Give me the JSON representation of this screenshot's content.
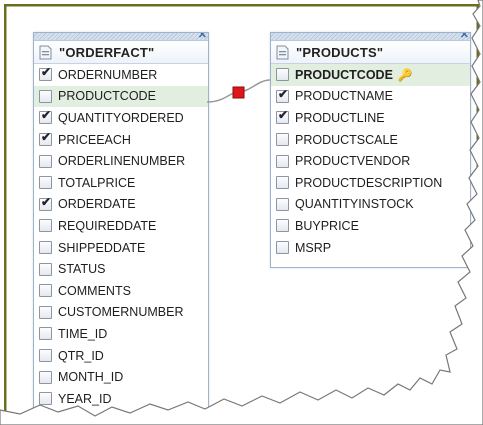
{
  "tables": {
    "orderfact": {
      "title": "\"ORDERFACT\"",
      "fields": [
        {
          "name": "ORDERNUMBER",
          "checked": true
        },
        {
          "name": "PRODUCTCODE",
          "checked": false,
          "selected": true
        },
        {
          "name": "QUANTITYORDERED",
          "checked": true
        },
        {
          "name": "PRICEEACH",
          "checked": true
        },
        {
          "name": "ORDERLINENUMBER",
          "checked": false
        },
        {
          "name": "TOTALPRICE",
          "checked": false
        },
        {
          "name": "ORDERDATE",
          "checked": true
        },
        {
          "name": "REQUIREDDATE",
          "checked": false
        },
        {
          "name": "SHIPPEDDATE",
          "checked": false
        },
        {
          "name": "STATUS",
          "checked": false
        },
        {
          "name": "COMMENTS",
          "checked": false
        },
        {
          "name": "CUSTOMERNUMBER",
          "checked": false
        },
        {
          "name": "TIME_ID",
          "checked": false
        },
        {
          "name": "QTR_ID",
          "checked": false
        },
        {
          "name": "MONTH_ID",
          "checked": false
        },
        {
          "name": "YEAR_ID",
          "checked": false
        }
      ]
    },
    "products": {
      "title": "\"PRODUCTS\"",
      "fields": [
        {
          "name": "PRODUCTCODE",
          "checked": false,
          "selected": true,
          "primary_key": true
        },
        {
          "name": "PRODUCTNAME",
          "checked": true
        },
        {
          "name": "PRODUCTLINE",
          "checked": true
        },
        {
          "name": "PRODUCTSCALE",
          "checked": false
        },
        {
          "name": "PRODUCTVENDOR",
          "checked": false
        },
        {
          "name": "PRODUCTDESCRIPTION",
          "checked": false
        },
        {
          "name": "QUANTITYINSTOCK",
          "checked": false
        },
        {
          "name": "BUYPRICE",
          "checked": false
        },
        {
          "name": "MSRP",
          "checked": false
        }
      ]
    }
  },
  "icons": {
    "close": "close-icon",
    "table": "table-icon",
    "key": "key-icon",
    "join": "join-icon"
  },
  "colors": {
    "frame_border": "#6b6f1c",
    "table_border": "#9db2cc",
    "selected_row": "#e1eee0",
    "join_handle": "#e0151b",
    "join_line": "#9a9a9a"
  }
}
